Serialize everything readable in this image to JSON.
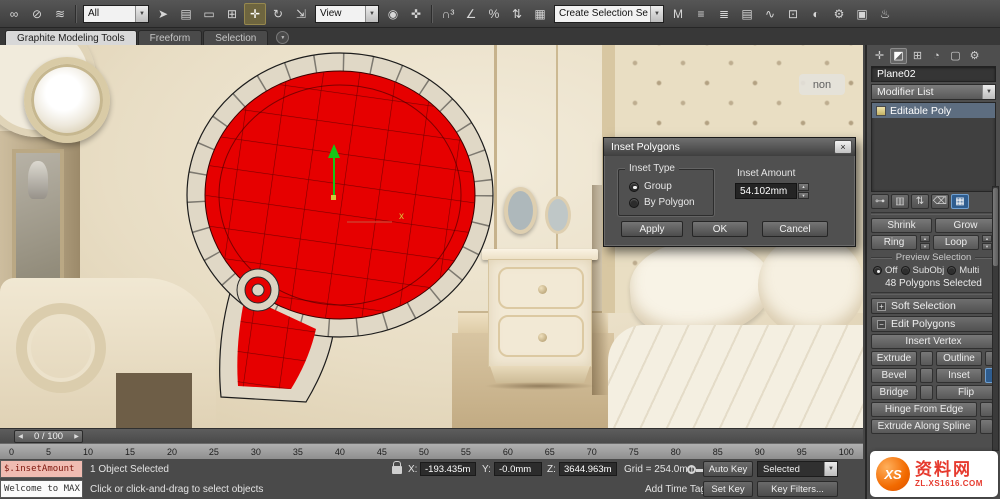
{
  "icons_ui": {
    "dropdown_arrow": "▼",
    "spin_up": "▲",
    "spin_down": "▼",
    "close": "×",
    "plus": "+",
    "minus": "−",
    "slider_left": "◀",
    "slider_right": "▶"
  },
  "toolbar": {
    "groups": {
      "g1": [
        {
          "n": "select-and-link-icon",
          "g": "∞"
        },
        {
          "n": "unlink-selection-icon",
          "g": "⊘"
        },
        {
          "n": "bind-to-spacewarp-icon",
          "g": "≋"
        }
      ],
      "g2": [
        {
          "n": "select-object-icon",
          "g": "➤"
        },
        {
          "n": "select-by-name-icon",
          "g": "▤"
        },
        {
          "n": "rectangular-selection-region-icon",
          "g": "▭"
        },
        {
          "n": "window-crossing-icon",
          "g": "⊞"
        }
      ],
      "g3": [
        {
          "n": "select-and-move-icon",
          "g": "✛",
          "a": "true"
        },
        {
          "n": "select-and-rotate-icon",
          "g": "↻"
        },
        {
          "n": "select-and-scale-icon",
          "g": "⇲"
        }
      ],
      "g4": [
        {
          "n": "use-center-icon",
          "g": "◉"
        },
        {
          "n": "select-and-manipulate-icon",
          "g": "✜"
        }
      ],
      "g5": [
        {
          "n": "snaps-toggle-icon",
          "g": "∩³"
        },
        {
          "n": "angle-snap-icon",
          "g": "∠"
        },
        {
          "n": "percent-snap-icon",
          "g": "%"
        },
        {
          "n": "spinner-snap-icon",
          "g": "⇅"
        }
      ],
      "g6": [
        {
          "n": "edit-named-selection-sets-icon",
          "g": "▦"
        }
      ],
      "g7": [
        {
          "n": "mirror-icon",
          "g": "M"
        },
        {
          "n": "align-icon",
          "g": "≡"
        },
        {
          "n": "layer-manager-icon",
          "g": "≣"
        },
        {
          "n": "ribbon-toggle-icon",
          "g": "▤"
        },
        {
          "n": "curve-editor-icon",
          "g": "∿"
        },
        {
          "n": "schematic-view-icon",
          "g": "⊡"
        },
        {
          "n": "material-editor-icon",
          "g": "◐"
        },
        {
          "n": "render-setup-icon",
          "g": "⚙"
        },
        {
          "n": "rendered-frame-window-icon",
          "g": "▣"
        },
        {
          "n": "render-production-icon",
          "g": "♨"
        }
      ]
    },
    "filter_dropdown": "All",
    "coord_dropdown": "View",
    "selection_set_placeholder": "Create Selection Se"
  },
  "ribbon": {
    "tabs": [
      {
        "label": "Graphite Modeling Tools",
        "active": "true"
      },
      {
        "label": "Freeform",
        "active": "false"
      },
      {
        "label": "Selection",
        "active": "false"
      }
    ]
  },
  "viewport": {
    "photo_watermark": "non",
    "gizmo_x_label": "x"
  },
  "dialog": {
    "title": "Inset Polygons",
    "inset_type_label": "Inset Type",
    "radio_group_label": "Group",
    "radio_by_polygon_label": "By Polygon",
    "inset_amount_label": "Inset Amount",
    "inset_amount_value": "54.102mm",
    "apply_label": "Apply",
    "ok_label": "OK",
    "cancel_label": "Cancel"
  },
  "panel": {
    "tabs": [
      {
        "n": "create-tab-icon",
        "g": "✛"
      },
      {
        "n": "modify-tab-icon",
        "g": "◩",
        "a": "true"
      },
      {
        "n": "hierarchy-tab-icon",
        "g": "⊞"
      },
      {
        "n": "motion-tab-icon",
        "g": "◔"
      },
      {
        "n": "display-tab-icon",
        "g": "▢"
      },
      {
        "n": "utilities-tab-icon",
        "g": "⚙"
      }
    ],
    "object_name": "Plane02",
    "modifier_list_label": "Modifier List",
    "stack_item": "Editable Poly",
    "stack_tools": [
      {
        "n": "pin-stack-icon",
        "g": "⊶"
      },
      {
        "n": "show-end-result-icon",
        "g": "▥"
      },
      {
        "n": "make-unique-icon",
        "g": "⇅"
      },
      {
        "n": "remove-modifier-icon",
        "g": "⌫"
      },
      {
        "n": "configure-modifier-sets-icon",
        "g": "▦",
        "a": "true"
      }
    ],
    "shrink_label": "Shrink",
    "grow_label": "Grow",
    "ring_label": "Ring",
    "loop_label": "Loop",
    "preview_selection_label": "Preview Selection",
    "preview_off_label": "Off",
    "preview_subobj_label": "SubObj",
    "preview_multi_label": "Multi",
    "selection_status": "48 Polygons Selected",
    "soft_selection_label": "Soft Selection",
    "edit_polygons_label": "Edit Polygons",
    "insert_vertex_label": "Insert Vertex",
    "extrude_label": "Extrude",
    "outline_label": "Outline",
    "bevel_label": "Bevel",
    "inset_label": "Inset",
    "bridge_label": "Bridge",
    "flip_label": "Flip",
    "hinge_label": "Hinge From Edge",
    "extrude_spline_label": "Extrude Along Spline"
  },
  "timeline": {
    "slider_label": "0 / 100",
    "ticks": [
      "0",
      "5",
      "10",
      "15",
      "20",
      "25",
      "30",
      "35",
      "40",
      "45",
      "50",
      "55",
      "60",
      "65",
      "70",
      "75",
      "80",
      "85",
      "90",
      "95",
      "100"
    ]
  },
  "statusbar": {
    "listener_line1": "$.insetAmount :",
    "listener_line2": "Welcome to MAX",
    "selection_status": "1 Object Selected",
    "prompt": "Click or click-and-drag to select objects",
    "x_label": "X:",
    "x_value": "-193.435m",
    "y_label": "Y:",
    "y_value": "-0.0mm",
    "z_label": "Z:",
    "z_value": "3644.963m",
    "grid_label": "Grid = 254.0mm",
    "add_time_tag": "Add Time Tag",
    "auto_key_label": "Auto Key",
    "set_key_label": "Set Key",
    "selected_dropdown": "Selected",
    "key_filters_label": "Key Filters..."
  },
  "watermark": {
    "logo_text": "XS",
    "site_name": "资料网",
    "domain": "ZL.XS1616.COM"
  }
}
